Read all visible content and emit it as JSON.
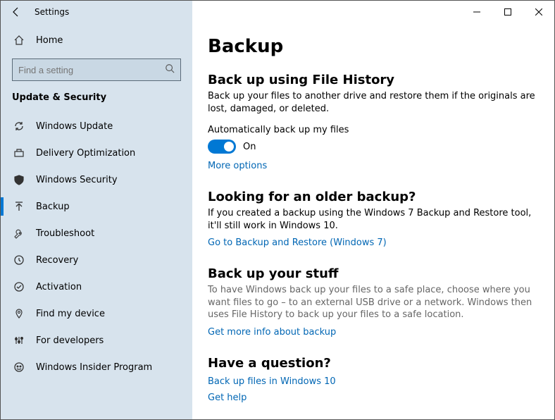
{
  "window": {
    "title": "Settings"
  },
  "sidebar": {
    "home": "Home",
    "search_placeholder": "Find a setting",
    "section": "Update & Security",
    "items": [
      {
        "label": "Windows Update"
      },
      {
        "label": "Delivery Optimization"
      },
      {
        "label": "Windows Security"
      },
      {
        "label": "Backup"
      },
      {
        "label": "Troubleshoot"
      },
      {
        "label": "Recovery"
      },
      {
        "label": "Activation"
      },
      {
        "label": "Find my device"
      },
      {
        "label": "For developers"
      },
      {
        "label": "Windows Insider Program"
      }
    ]
  },
  "main": {
    "title": "Backup",
    "file_history": {
      "heading": "Back up using File History",
      "desc": "Back up your files to another drive and restore them if the originals are lost, damaged, or deleted.",
      "auto_label": "Automatically back up my files",
      "toggle_state": "On",
      "more_options": "More options"
    },
    "older": {
      "heading": "Looking for an older backup?",
      "desc": "If you created a backup using the Windows 7 Backup and Restore tool, it'll still work in Windows 10.",
      "link": "Go to Backup and Restore (Windows 7)"
    },
    "stuff": {
      "heading": "Back up your stuff",
      "desc": "To have Windows back up your files to a safe place, choose where you want files to go – to an external USB drive or a network. Windows then uses File History to back up your files to a safe location.",
      "link": "Get more info about backup"
    },
    "question": {
      "heading": "Have a question?",
      "link1": "Back up files in Windows 10",
      "link2": "Get help"
    }
  }
}
